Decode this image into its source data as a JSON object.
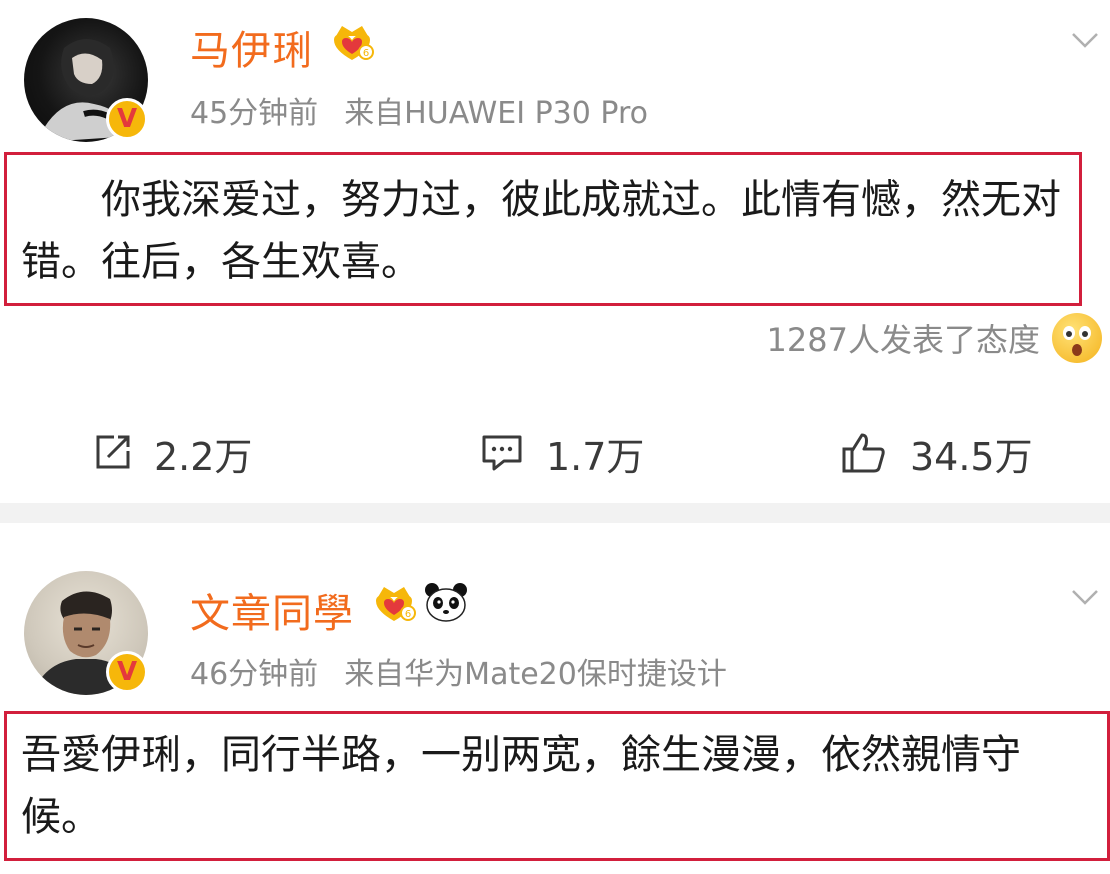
{
  "posts": [
    {
      "username": "马伊琍",
      "time": "45分钟前",
      "source": "来自HUAWEI P30 Pro",
      "content": "你我深爱过，努力过，彼此成就过。此情有憾，然无对错。往后，各生欢喜。",
      "reactions_text": "1287人发表了态度",
      "repost_count": "2.2万",
      "comment_count": "1.7万",
      "like_count": "34.5万"
    },
    {
      "username": "文章同學",
      "time": "46分钟前",
      "source": "来自华为Mate20保时捷设计",
      "content": "吾愛伊琍，同行半路，一别两宽，餘生漫漫，依然親情守候。"
    }
  ],
  "icons": {
    "verified": "V",
    "vip": "crown-heart-icon",
    "panda": "panda-emoji-icon",
    "reaction": "surprised-face-icon",
    "chevron": "chevron-down-icon"
  },
  "colors": {
    "username": "#f26b1d",
    "highlight_border": "#d21f3c",
    "meta_text": "#8a8a8a",
    "verified_badge": "#f6b70a"
  }
}
